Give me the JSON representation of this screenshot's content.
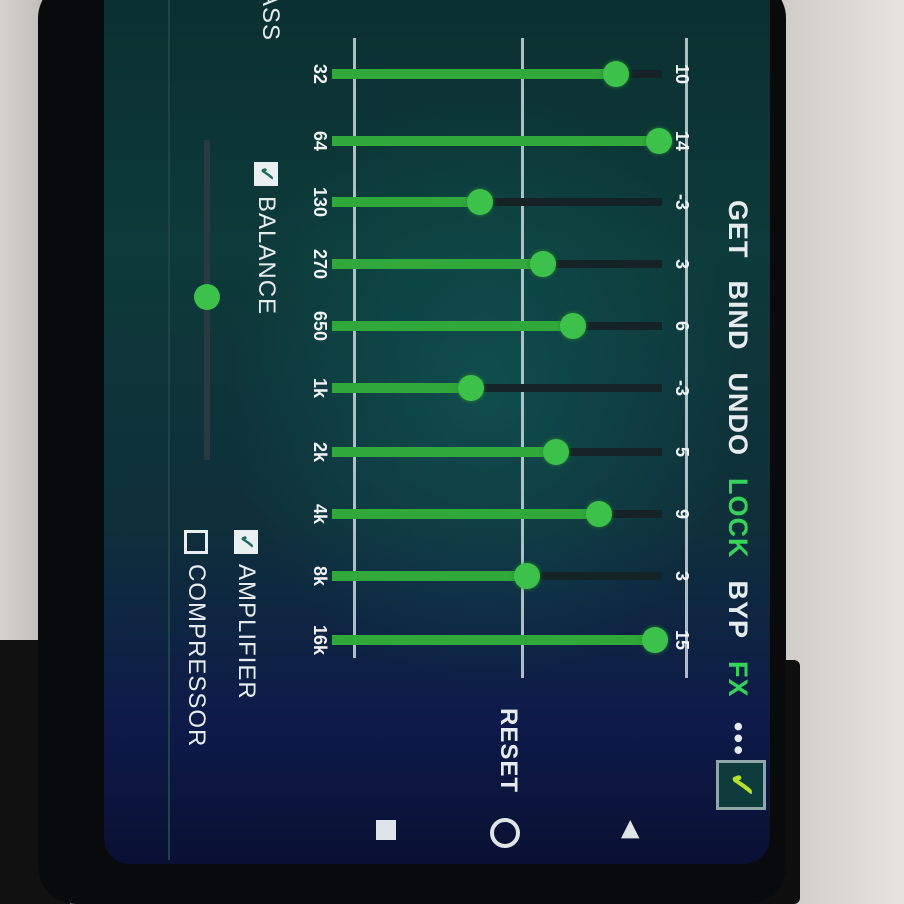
{
  "toolbar": {
    "items": [
      {
        "label": "GET",
        "active": false
      },
      {
        "label": "BIND",
        "active": false
      },
      {
        "label": "UNDO",
        "active": false
      },
      {
        "label": "LOCK",
        "active": true
      },
      {
        "label": "BYP",
        "active": false
      },
      {
        "label": "FX",
        "active": true
      }
    ],
    "more": "•••",
    "enable_check": "✓"
  },
  "equalizer": {
    "bands": [
      {
        "freq": "32",
        "gain": "10"
      },
      {
        "freq": "64",
        "gain": "14"
      },
      {
        "freq": "130",
        "gain": "-3"
      },
      {
        "freq": "270",
        "gain": "3"
      },
      {
        "freq": "650",
        "gain": "6"
      },
      {
        "freq": "1k",
        "gain": "-3"
      },
      {
        "freq": "2k",
        "gain": "5"
      },
      {
        "freq": "4k",
        "gain": "9"
      },
      {
        "freq": "8k",
        "gain": "3"
      },
      {
        "freq": "16k",
        "gain": "15"
      }
    ],
    "reset_label": "RESET"
  },
  "options": {
    "balance": {
      "label": "BALANCE",
      "checked": true
    },
    "amplifier": {
      "label": "AMPLIFIER",
      "checked": true
    },
    "compressor": {
      "label": "COMPRESSOR",
      "checked": false
    },
    "bass_label": "ASS"
  },
  "colors": {
    "accent": "#35d35a",
    "slider": "#31a83a",
    "text": "#e6ebee"
  }
}
